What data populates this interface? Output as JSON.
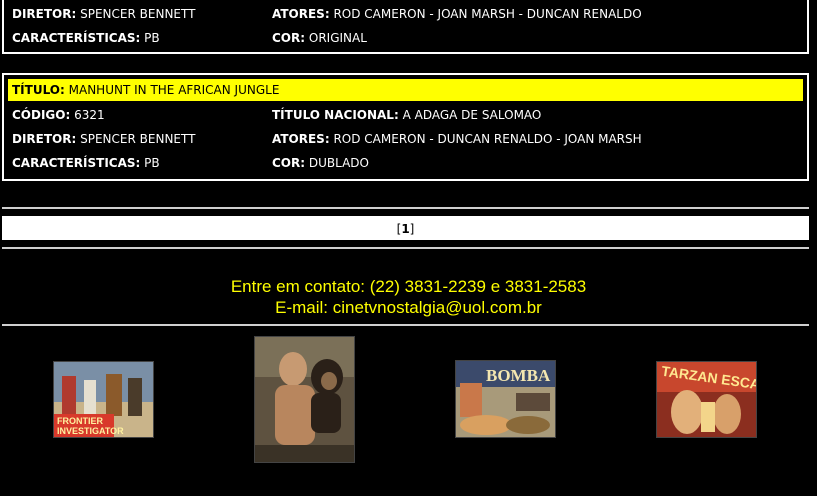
{
  "record1": {
    "diretor_label": "DIRETOR:",
    "diretor": "SPENCER BENNETT",
    "atores_label": "ATORES:",
    "atores": "ROD CAMERON - JOAN MARSH - DUNCAN RENALDO",
    "caracteristicas_label": "CARACTERÍSTICAS:",
    "caracteristicas": "PB",
    "cor_label": "COR:",
    "cor": "ORIGINAL"
  },
  "record2": {
    "titulo_label": "TÍTULO:",
    "titulo": "MANHUNT IN THE AFRICAN JUNGLE",
    "codigo_label": "CÓDIGO:",
    "codigo": "6321",
    "titulo_nacional_label": "TÍTULO NACIONAL:",
    "titulo_nacional": "A ADAGA DE SALOMAO",
    "diretor_label": "DIRETOR:",
    "diretor": "SPENCER BENNETT",
    "atores_label": "ATORES:",
    "atores": "ROD CAMERON - DUNCAN RENALDO - JOAN MARSH",
    "caracteristicas_label": "CARACTERÍSTICAS:",
    "caracteristicas": "PB",
    "cor_label": "COR:",
    "cor": "DUBLADO"
  },
  "pager": {
    "open": "[",
    "page": "1",
    "close": "]"
  },
  "contact": {
    "phone_line": "Entre em contato: (22) 3831-2239 e 3831-2583",
    "email_line": "E-mail: cinetvnostalgia@uol.com.br"
  },
  "posters": [
    {
      "title_text": "FRONTIER INVESTIGATOR",
      "colors": [
        "#b03a2e",
        "#e8c05a"
      ]
    },
    {
      "title_text": "",
      "colors": [
        "#6b5a45",
        "#c79a72"
      ]
    },
    {
      "title_text": "BOMBA",
      "colors": [
        "#3b4a6b",
        "#e0c070"
      ]
    },
    {
      "title_text": "TARZAN ESCAPES",
      "colors": [
        "#b5321f",
        "#f0d070"
      ]
    }
  ]
}
